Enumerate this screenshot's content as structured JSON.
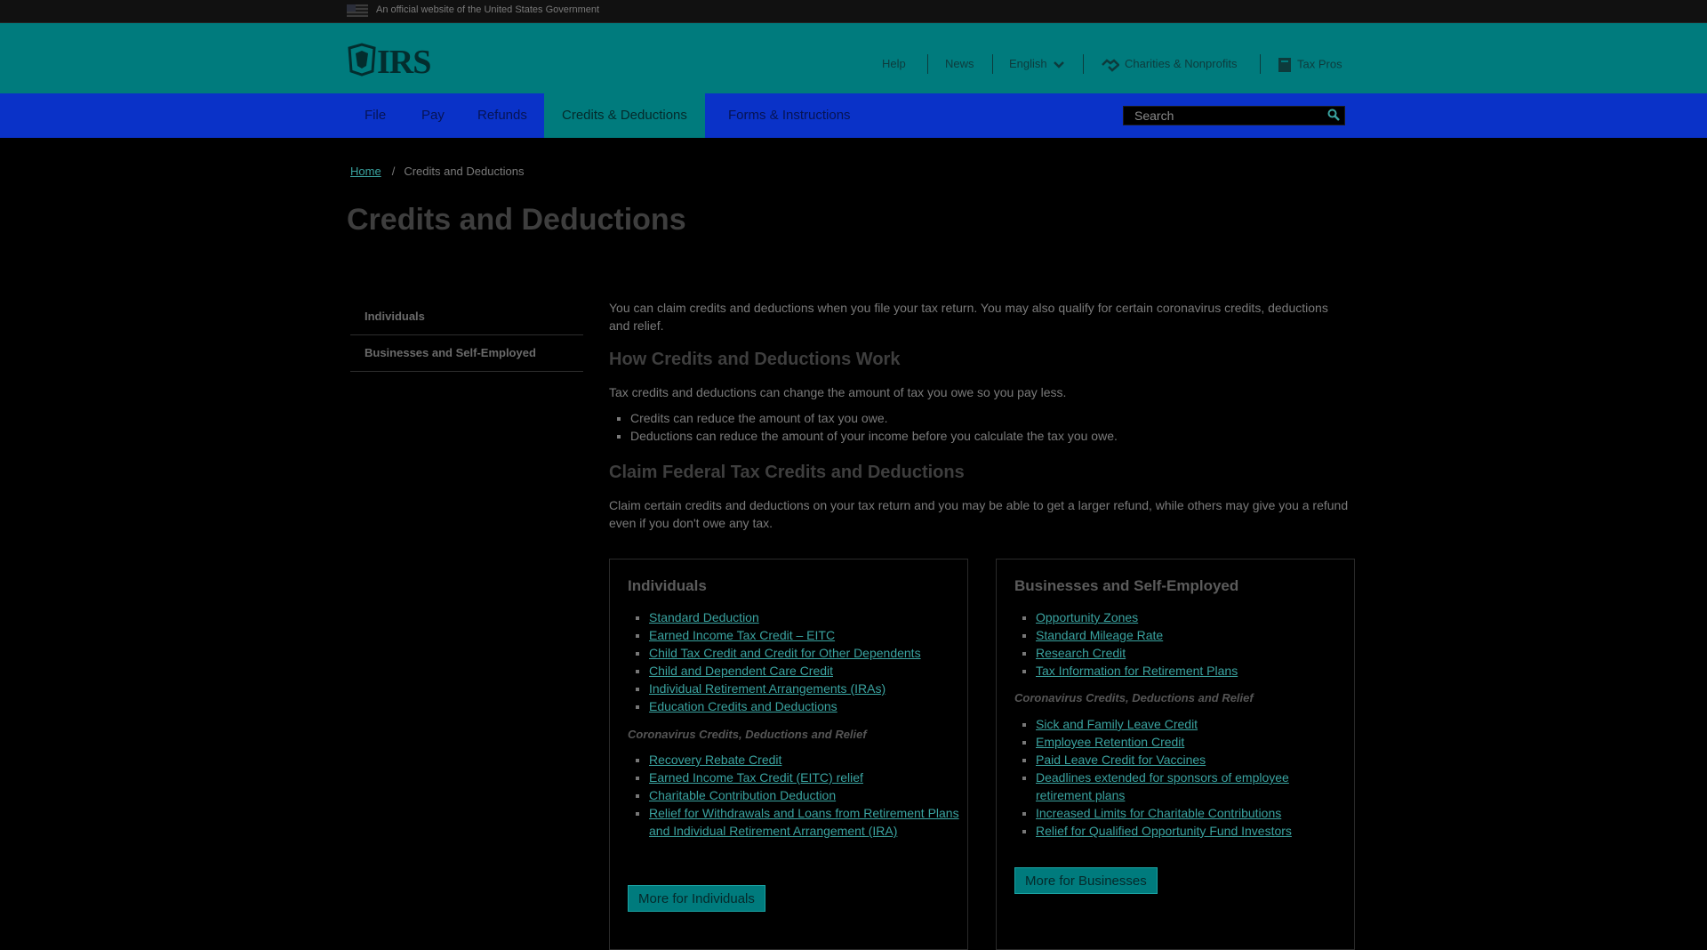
{
  "gov_banner": {
    "text": "An official website of the United States Government"
  },
  "header": {
    "logo": "IRS",
    "util": {
      "help": "Help",
      "news": "News",
      "language": "English",
      "charities": "Charities & Nonprofits",
      "tax_pros": "Tax Pros"
    }
  },
  "nav": {
    "items": [
      "File",
      "Pay",
      "Refunds",
      "Credits & Deductions",
      "Forms & Instructions"
    ],
    "active": "Credits & Deductions",
    "search_placeholder": "Search"
  },
  "breadcrumb": {
    "home": "Home",
    "sep": "/",
    "current": "Credits and Deductions"
  },
  "title": "Credits and Deductions",
  "sidebar": {
    "items": [
      "Individuals",
      "Businesses and Self-Employed"
    ]
  },
  "main": {
    "intro": "You can claim credits and deductions when you file your tax return. You may also qualify for certain coronavirus credits, deductions and relief.",
    "h_work": "How Credits and Deductions Work",
    "work_text": "Tax credits and deductions can change the amount of tax you owe so you pay less.",
    "work_bullets": [
      "Credits can reduce the amount of tax you owe.",
      "Deductions can reduce the amount of your income before you calculate the tax you owe."
    ],
    "h_claim": "Claim Federal Tax Credits and Deductions",
    "claim_text": "Claim certain credits and deductions on your tax return and you may be able to get a larger refund, while others may give you a refund even if you don't owe any tax."
  },
  "individuals_card": {
    "title": "Individuals",
    "links": [
      "Standard Deduction",
      "Earned Income Tax Credit – EITC",
      "Child Tax Credit and Credit for Other Dependents",
      "Child and Dependent Care Credit",
      "Individual Retirement Arrangements (IRAs)",
      "Education Credits and Deductions"
    ],
    "covid_heading": "Coronavirus Credits, Deductions and Relief",
    "covid_links": [
      "Recovery Rebate Credit",
      "Earned Income Tax Credit (EITC) relief",
      "Charitable Contribution Deduction",
      "Relief for Withdrawals and Loans from Retirement Plans and Individual Retirement Arrangement (IRA)"
    ],
    "button": "More for Individuals"
  },
  "business_card": {
    "title": "Businesses and Self-Employed",
    "links": [
      "Opportunity Zones",
      "Standard Mileage Rate",
      "Research Credit",
      "Tax Information for Retirement Plans"
    ],
    "covid_heading": "Coronavirus Credits, Deductions and Relief",
    "covid_links": [
      "Sick and Family Leave Credit",
      "Employee Retention Credit",
      "Paid Leave Credit for Vaccines",
      "Deadlines extended for sponsors of employee retirement plans",
      "Increased Limits for Charitable Contributions",
      "Relief for Qualified Opportunity Fund Investors"
    ],
    "button": "More for Businesses"
  }
}
